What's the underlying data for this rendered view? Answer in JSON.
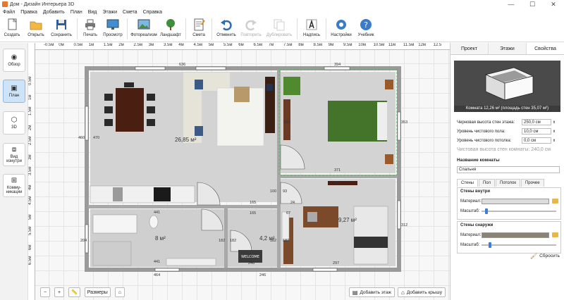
{
  "window": {
    "title": "Дом - Дизайн Интерьера 3D",
    "minimize": "—",
    "maximize": "☐",
    "close": "✕"
  },
  "menu": [
    "Файл",
    "Правка",
    "Добавить",
    "План",
    "Вид",
    "Этажи",
    "Смета",
    "Справка"
  ],
  "toolbar": {
    "create": "Создать",
    "open": "Открыть",
    "save": "Сохранить",
    "print": "Печать",
    "preview": "Просмотр",
    "photorealism": "Фотореализм",
    "landscape": "Ландшафт",
    "estimate": "Смета",
    "undo": "Отменить",
    "redo": "Повторить",
    "duplicate": "Дублировать",
    "label": "Надпись",
    "settings": "Настройки",
    "tutorial": "Учебник"
  },
  "sidebar": [
    "Обзор",
    "План",
    "3D",
    "Вид изнутри",
    "Комму-никации"
  ],
  "ruler_top": [
    "-0.5м",
    "0м",
    "0.5м",
    "1м",
    "1.5м",
    "2м",
    "2.5м",
    "3м",
    "3.5м",
    "4м",
    "4.5м",
    "5м",
    "5.5м",
    "6м",
    "6.5м",
    "7м",
    "7.5м",
    "8м",
    "8.5м",
    "9м",
    "9.5м",
    "10м",
    "10.5м",
    "11м",
    "11.5м",
    "12м",
    "12.5"
  ],
  "ruler_left": [
    "0.5м",
    "1м",
    "1.5м",
    "2м",
    "2.5м",
    "3м",
    "3.5м",
    "4м",
    "4.5м",
    "5м",
    "5.5м",
    "6м",
    "6.5м"
  ],
  "plan": {
    "dims": {
      "top_left": "636",
      "top_right": "394",
      "left_outer": "460",
      "left_inner": "470",
      "bed_h": "330",
      "right_outer": "353",
      "bed_w": "371",
      "hall_h": "100",
      "sep_93": "93",
      "bed2_w": "371",
      "d165a": "165",
      "d165b": "165",
      "d67": "67",
      "d24": "24",
      "bath_w": "441",
      "bath_w2": "441",
      "bath_h": "204",
      "d182a": "182",
      "d182b": "182",
      "d182c": "182",
      "d182d": "182",
      "d246": "246",
      "d297": "297",
      "d312": "312",
      "bottom_left": "464",
      "bottom_mid": "246"
    },
    "areas": {
      "living": "26,85 м²",
      "bath": "8 м²",
      "wc": "4,2 м²",
      "office": "9,27 м²"
    },
    "rug_text": "WELCOME"
  },
  "canvas_tools": {
    "zoom_out": "−",
    "zoom_in": "+",
    "sizes": "Размеры",
    "home": "⌂"
  },
  "canvas_actions": {
    "add_floor": "Добавить этаж",
    "add_roof": "Добавить крышу"
  },
  "panel": {
    "tabs": [
      "Проект",
      "Этажи",
      "Свойства"
    ],
    "preview_caption": "Комната 12,26 м² (площадь стен 35,07 м²)",
    "props": [
      {
        "label": "Черновая высота стен этажа:",
        "value": "250,0 см"
      },
      {
        "label": "Уровень чистового пола:",
        "value": "10,0 см"
      },
      {
        "label": "Уровень чистового потолка:",
        "value": "0,0 см"
      }
    ],
    "clean_height": "Чистовая высота стен комнаты: 240,0 см",
    "room_name_label": "Название комнаты",
    "room_name": "Спальня",
    "subtabs": [
      "Стены",
      "Пол",
      "Потолок",
      "Прочее"
    ],
    "inner": {
      "title": "Стены внутри",
      "material": "Материал:",
      "scale": "Масштаб:",
      "scale_value": 0.05,
      "color": "#dcdcdc"
    },
    "outer": {
      "title": "Стены снаружи",
      "material": "Материал:",
      "scale": "Масштаб:",
      "scale_value": 0.1,
      "color": "#8c8274"
    },
    "reset": "Сбросить"
  }
}
